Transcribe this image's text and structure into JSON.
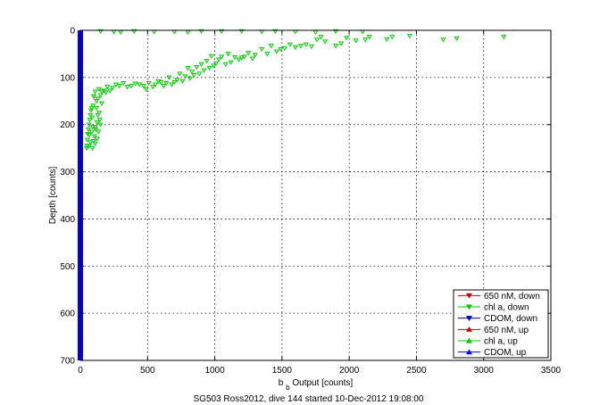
{
  "chart_data": {
    "type": "scatter",
    "title": "",
    "xlabel_main": "b",
    "xlabel_sub": "b",
    "xlabel_rest": " Output [counts]",
    "ylabel": "Depth [counts]",
    "caption": "SG503 Ross2012, dive 144 started 10-Dec-2012 19:08:00",
    "xlim": [
      0,
      3500
    ],
    "ylim": [
      0,
      700
    ],
    "y_reversed": true,
    "grid": true,
    "legend_placement": "bottom-right",
    "xticks": [
      0,
      500,
      1000,
      1500,
      2000,
      2500,
      3000,
      3500
    ],
    "yticks": [
      0,
      100,
      200,
      300,
      400,
      500,
      600,
      700
    ],
    "series": [
      {
        "name": "650 nM, down",
        "color": "#cc0000",
        "marker": "triangle-down",
        "values": []
      },
      {
        "name": "chl a, down",
        "color": "#00cc00",
        "marker": "triangle-down",
        "values": [
          [
            3150,
            14
          ],
          [
            2800,
            17
          ],
          [
            2700,
            20
          ],
          [
            2450,
            12
          ],
          [
            2320,
            14
          ],
          [
            2280,
            19
          ],
          [
            2150,
            14
          ],
          [
            2120,
            20
          ],
          [
            2050,
            22
          ],
          [
            1980,
            16
          ],
          [
            1940,
            28
          ],
          [
            1900,
            33
          ],
          [
            1820,
            24
          ],
          [
            1790,
            14
          ],
          [
            1760,
            20
          ],
          [
            1720,
            34
          ],
          [
            1680,
            30
          ],
          [
            1640,
            33
          ],
          [
            1600,
            36
          ],
          [
            1560,
            30
          ],
          [
            1520,
            38
          ],
          [
            1490,
            40
          ],
          [
            1460,
            45
          ],
          [
            1420,
            33
          ],
          [
            1390,
            50
          ],
          [
            1350,
            40
          ],
          [
            1300,
            52
          ],
          [
            1280,
            60
          ],
          [
            1250,
            48
          ],
          [
            1220,
            56
          ],
          [
            1200,
            58
          ],
          [
            1180,
            62
          ],
          [
            1150,
            57
          ],
          [
            1120,
            68
          ],
          [
            1100,
            50
          ],
          [
            1080,
            72
          ],
          [
            1050,
            56
          ],
          [
            1030,
            62
          ],
          [
            1010,
            70
          ],
          [
            990,
            75
          ],
          [
            975,
            55
          ],
          [
            960,
            80
          ],
          [
            940,
            65
          ],
          [
            920,
            85
          ],
          [
            900,
            72
          ],
          [
            885,
            92
          ],
          [
            865,
            78
          ],
          [
            845,
            95
          ],
          [
            830,
            88
          ],
          [
            815,
            102
          ],
          [
            800,
            80
          ],
          [
            780,
            98
          ],
          [
            760,
            108
          ],
          [
            740,
            92
          ],
          [
            720,
            105
          ],
          [
            700,
            110
          ],
          [
            680,
            115
          ],
          [
            660,
            100
          ],
          [
            640,
            112
          ],
          [
            620,
            118
          ],
          [
            600,
            110
          ],
          [
            580,
            108
          ],
          [
            560,
            115
          ],
          [
            540,
            120
          ],
          [
            510,
            112
          ],
          [
            490,
            125
          ],
          [
            470,
            118
          ],
          [
            440,
            115
          ],
          [
            410,
            113
          ],
          [
            380,
            118
          ],
          [
            350,
            120
          ],
          [
            320,
            112
          ],
          [
            290,
            118
          ],
          [
            265,
            115
          ],
          [
            240,
            122
          ],
          [
            220,
            128
          ],
          [
            200,
            120
          ],
          [
            190,
            132
          ],
          [
            175,
            128
          ],
          [
            160,
            130
          ],
          [
            150,
            138
          ],
          [
            140,
            125
          ],
          [
            130,
            145
          ],
          [
            120,
            150
          ],
          [
            110,
            130
          ],
          [
            100,
            140
          ],
          [
            95,
            160
          ],
          [
            85,
            165
          ],
          [
            80,
            170
          ],
          [
            75,
            180
          ],
          [
            70,
            190
          ],
          [
            65,
            200
          ],
          [
            60,
            210
          ],
          [
            55,
            220
          ],
          [
            52,
            232
          ],
          [
            50,
            245
          ],
          [
            48,
            250
          ],
          [
            130,
            180
          ],
          [
            125,
            195
          ],
          [
            115,
            210
          ],
          [
            105,
            225
          ],
          [
            98,
            235
          ],
          [
            92,
            205
          ],
          [
            88,
            185
          ],
          [
            120,
            165
          ],
          [
            140,
            175
          ],
          [
            150,
            200
          ],
          [
            135,
            215
          ],
          [
            110,
            240
          ],
          [
            75,
            238
          ],
          [
            68,
            222
          ],
          [
            90,
            250
          ],
          [
            100,
            140
          ],
          [
            160,
            155
          ],
          [
            145,
            190
          ],
          [
            125,
            230
          ],
          [
            85,
            215
          ],
          [
            65,
            245
          ],
          [
            110,
            205
          ],
          [
            900,
            2
          ],
          [
            1200,
            2
          ],
          [
            1600,
            3
          ],
          [
            700,
            3
          ],
          [
            400,
            2
          ],
          [
            250,
            3
          ],
          [
            150,
            2
          ],
          [
            1900,
            2
          ],
          [
            2100,
            3
          ],
          [
            1350,
            3
          ],
          [
            1050,
            2
          ],
          [
            550,
            3
          ],
          [
            300,
            4
          ],
          [
            1750,
            4
          ],
          [
            1450,
            2
          ],
          [
            800,
            4
          ]
        ]
      },
      {
        "name": "CDOM, down",
        "color": "#0000aa",
        "marker": "triangle-down",
        "values": []
      },
      {
        "name": "650 nM, up",
        "color": "#cc0000",
        "marker": "triangle-up",
        "values": []
      },
      {
        "name": "chl a, up",
        "color": "#00cc00",
        "marker": "triangle-up",
        "values": []
      },
      {
        "name": "CDOM, up",
        "color": "#0000ff",
        "marker": "triangle-up",
        "vertical_band": {
          "x": 0,
          "y_from": 0,
          "y_to": 700
        }
      }
    ]
  }
}
